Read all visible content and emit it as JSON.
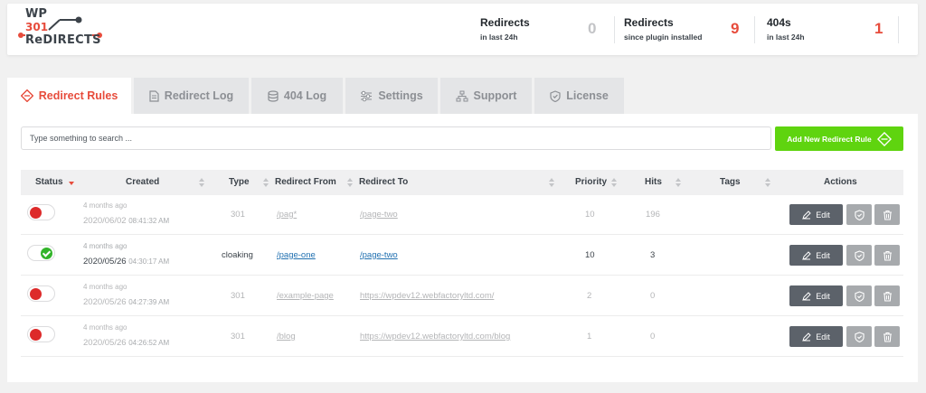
{
  "logo": {
    "line1": "WP",
    "line2": "301",
    "line3": "ReDIRECTS"
  },
  "stats": [
    {
      "label": "Redirects",
      "sub": "in last 24h",
      "value": "0",
      "color": "#c3c4c7"
    },
    {
      "label": "Redirects",
      "sub": "since plugin installed",
      "value": "9",
      "color": "#e74c3c"
    },
    {
      "label": "404s",
      "sub": "in last 24h",
      "value": "1",
      "color": "#e74c3c"
    }
  ],
  "tabs": [
    {
      "label": "Redirect Rules",
      "icon": "diamond-arrows-icon",
      "active": true
    },
    {
      "label": "Redirect Log",
      "icon": "document-icon",
      "active": false
    },
    {
      "label": "404 Log",
      "icon": "database-icon",
      "active": false
    },
    {
      "label": "Settings",
      "icon": "sliders-icon",
      "active": false
    },
    {
      "label": "Support",
      "icon": "sitemap-icon",
      "active": false
    },
    {
      "label": "License",
      "icon": "shield-check-icon",
      "active": false
    }
  ],
  "search": {
    "placeholder": "Type something to search ..."
  },
  "add_button": {
    "label": "Add New Redirect Rule"
  },
  "columns": [
    "Status",
    "Created",
    "Type",
    "Redirect From",
    "Redirect To",
    "Priority",
    "Hits",
    "Tags",
    "Actions"
  ],
  "rows": [
    {
      "enabled": false,
      "ago": "4 months ago",
      "date": "2020/06/02",
      "time": "08:41:32 AM",
      "type": "301",
      "from": "/pag*",
      "to": "/page-two",
      "priority": "10",
      "hits": "196"
    },
    {
      "enabled": true,
      "ago": "4 months ago",
      "date": "2020/05/26",
      "time": "04:30:17 AM",
      "type": "cloaking",
      "from": "/page-one",
      "to": "/page-two",
      "priority": "10",
      "hits": "3"
    },
    {
      "enabled": false,
      "ago": "4 months ago",
      "date": "2020/05/26",
      "time": "04:27:39 AM",
      "type": "301",
      "from": "/example-page",
      "to": "https://wpdev12.webfactoryltd.com/",
      "priority": "2",
      "hits": "0"
    },
    {
      "enabled": false,
      "ago": "4 months ago",
      "date": "2020/05/26",
      "time": "04:26:52 AM",
      "type": "301",
      "from": "/blog",
      "to": "https://wpdev12.webfactoryltd.com/blog",
      "priority": "1",
      "hits": "0"
    }
  ],
  "actions": {
    "edit_label": "Edit"
  }
}
